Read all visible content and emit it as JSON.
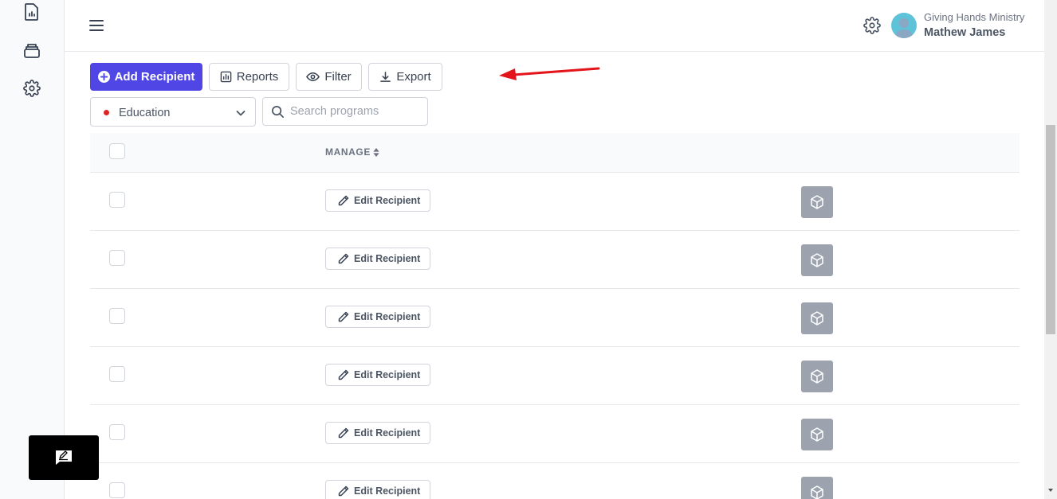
{
  "sidebar": {
    "icons": [
      "report-document-icon",
      "inbox-tray-icon",
      "settings-gear-icon"
    ]
  },
  "chat_widget": {
    "icon": "feedback-chat-icon"
  },
  "header": {
    "org_name": "Giving Hands Ministry",
    "user_name": "Mathew James"
  },
  "toolbar": {
    "add_label": "Add Recipient",
    "reports_label": "Reports",
    "filter_label": "Filter",
    "export_label": "Export"
  },
  "filters": {
    "program_value": "Education",
    "program_dot_color": "#e02424",
    "search_placeholder": "Search programs"
  },
  "table": {
    "header_manage": "MANAGE",
    "rows": [
      {
        "edit_label": "Edit Recipient"
      },
      {
        "edit_label": "Edit Recipient"
      },
      {
        "edit_label": "Edit Recipient"
      },
      {
        "edit_label": "Edit Recipient"
      },
      {
        "edit_label": "Edit Recipient"
      },
      {
        "edit_label": "Edit Recipient"
      }
    ]
  },
  "colors": {
    "primary": "#4f46e5",
    "annotation_arrow": "#e3151a",
    "box_button": "#9ca3af"
  }
}
